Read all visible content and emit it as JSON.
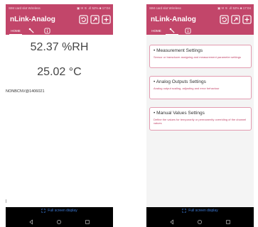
{
  "status_bar": {
    "left_text": "SIM card slot Wireless",
    "right_text": "▣ ✉ ⚟ .ıll 52% ■ 17:04"
  },
  "app": {
    "title": "nLink-Analog",
    "accent_color": "#c2466a",
    "actions": [
      "refresh-icon",
      "share-icon",
      "add-icon"
    ]
  },
  "tabs": [
    {
      "label": "HOME",
      "icon": null
    },
    {
      "label": "",
      "icon": "wrench-icon"
    },
    {
      "label": "",
      "icon": "info-icon"
    }
  ],
  "home": {
    "humidity": "52.37 %RH",
    "temperature": "25.02 °C",
    "device_id": "NONBCNV@1406021"
  },
  "settings": {
    "cards": [
      {
        "title": "• Measurement Settings",
        "description": "Sensor or transducer assigning and measurement parameter settings"
      },
      {
        "title": "• Analog Outputs Settings",
        "description": "Analog output scaling, adjusting and error behaviour"
      },
      {
        "title": "• Manual Values Settings",
        "description": "Define the values for temporarily or permanently overriding of the channel values"
      }
    ]
  },
  "fullscreen_label": "Full screen display",
  "nav_icons": [
    "back-icon",
    "home-icon",
    "recents-icon"
  ]
}
